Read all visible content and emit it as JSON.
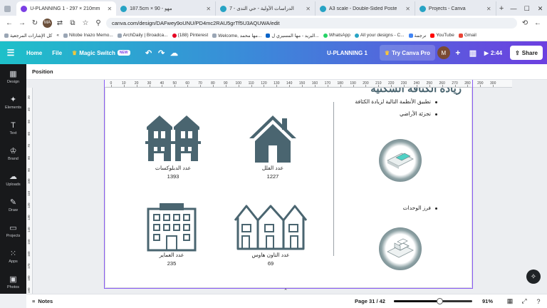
{
  "browser": {
    "tabs": [
      {
        "title": "U-PLANNING 1 - 297 × 210mm",
        "active": true
      },
      {
        "title": "187.5cm × 90 - مهو"
      },
      {
        "title": "الدراسات الأولية - حي الندى - 7"
      },
      {
        "title": "A3 scale - Double-Sided Poste"
      },
      {
        "title": "Projects - Canva"
      }
    ],
    "new_tab_label": "+",
    "url": "canva.com/design/DAFwey9oUNU/PD4mc2RAU5grTf5U3AQUWA/edit",
    "profile_initials": "MA",
    "bookmarks": [
      "كل الإشارات المرجعية",
      "Nitobe Inazo Memo...",
      "ArchDaily | Broadca...",
      "(188) Pinterest",
      "Welcome, مها محمد...",
      "البريد - مها المسيري ل...",
      "WhatsApp",
      "All your designs - C...",
      "ترجمة",
      "YouTube",
      "Gmail"
    ]
  },
  "canva_header": {
    "home": "Home",
    "file": "File",
    "magic_switch": "Magic Switch",
    "new_badge": "NEW",
    "doc_title": "U-PLANNING 1",
    "try_pro": "Try Canva Pro",
    "user_initial": "M",
    "duration": "2:44",
    "share": "Share"
  },
  "left_rail": [
    {
      "label": "Design",
      "icon": "layout-icon"
    },
    {
      "label": "Elements",
      "icon": "elements-icon"
    },
    {
      "label": "Text",
      "icon": "text-icon"
    },
    {
      "label": "Brand",
      "icon": "brand-icon"
    },
    {
      "label": "Uploads",
      "icon": "upload-icon"
    },
    {
      "label": "Draw",
      "icon": "draw-icon"
    },
    {
      "label": "Projects",
      "icon": "folder-icon"
    },
    {
      "label": "Apps",
      "icon": "apps-icon"
    },
    {
      "label": "Photos",
      "icon": "photos-icon"
    }
  ],
  "toolbar": {
    "position_label": "Position"
  },
  "ruler": {
    "top_ticks": [
      "0",
      "10",
      "20",
      "30",
      "40",
      "50",
      "60",
      "70",
      "80",
      "90",
      "100",
      "110",
      "120",
      "130",
      "140",
      "150",
      "160",
      "170",
      "180",
      "190",
      "200",
      "210",
      "220",
      "230",
      "240",
      "250",
      "260",
      "270",
      "280",
      "290",
      "300"
    ],
    "left_ticks": [
      "30",
      "40",
      "50",
      "60",
      "70",
      "80",
      "90",
      "100",
      "110",
      "120",
      "130",
      "140",
      "150",
      "160",
      "170",
      "180",
      "190"
    ]
  },
  "slide": {
    "heading_partial": "زيادة الكثافة السكنية",
    "list": [
      "تطبيق الأنظمة التالية لزيادة الكثافة",
      "تجزئة الأراضي",
      "فرز الوحدات"
    ],
    "stats": {
      "duplex": {
        "label": "عدد الدبلوكسات",
        "value": "1393"
      },
      "villa": {
        "label": "عدد الفلل",
        "value": "1227"
      },
      "apartments": {
        "label": "عدد العماير",
        "value": "235"
      },
      "townhouse": {
        "label": "عدد التاون هاوس",
        "value": "69"
      }
    },
    "icon_color": "#4a6570"
  },
  "bottom_bar": {
    "notes": "Notes",
    "page_indicator": "Page 31 / 42",
    "zoom_fraction": 0.91,
    "zoom_label": "91%"
  }
}
